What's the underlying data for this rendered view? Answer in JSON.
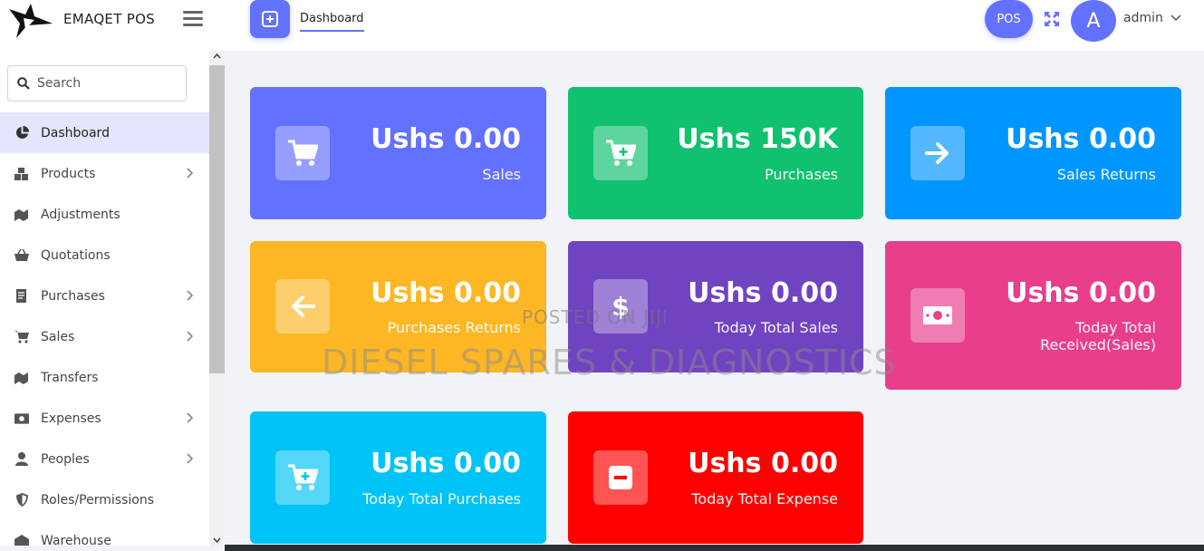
{
  "app": {
    "brand": "EMAQET POS"
  },
  "header": {
    "tab_label": "Dashboard",
    "pos_label": "POS",
    "avatar_letter": "A",
    "user_name": "admin"
  },
  "search": {
    "placeholder": "Search"
  },
  "sidebar": {
    "items": [
      {
        "label": "Dashboard",
        "icon": "pie-chart-icon",
        "active": true
      },
      {
        "label": "Products",
        "icon": "boxes-icon",
        "has_children": true
      },
      {
        "label": "Adjustments",
        "icon": "adjust-icon"
      },
      {
        "label": "Quotations",
        "icon": "basket-icon"
      },
      {
        "label": "Purchases",
        "icon": "receipt-icon",
        "has_children": true
      },
      {
        "label": "Sales",
        "icon": "cart-icon",
        "has_children": true
      },
      {
        "label": "Transfers",
        "icon": "transfer-icon"
      },
      {
        "label": "Expenses",
        "icon": "money-icon",
        "has_children": true
      },
      {
        "label": "Peoples",
        "icon": "user-icon",
        "has_children": true
      },
      {
        "label": "Roles/Permissions",
        "icon": "shield-icon"
      },
      {
        "label": "Warehouse",
        "icon": "warehouse-icon"
      }
    ]
  },
  "cards": [
    {
      "amount": "Ushs 0.00",
      "label": "Sales",
      "color": "#6371ff",
      "icon": "cart-icon"
    },
    {
      "amount": "Ushs 150K",
      "label": "Purchases",
      "color": "#10c16f",
      "icon": "cart-plus-icon"
    },
    {
      "amount": "Ushs 0.00",
      "label": "Sales Returns",
      "color": "#0096ff",
      "icon": "arrow-right-icon"
    },
    {
      "amount": "Ushs 0.00",
      "label": "Purchases Returns",
      "color": "#fdb624",
      "icon": "arrow-left-icon"
    },
    {
      "amount": "Ushs 0.00",
      "label": "Today Total Sales",
      "color": "#7043c1",
      "icon": "dollar-icon"
    },
    {
      "amount": "Ushs 0.00",
      "label_line1": "Today Total",
      "label_line2": "Received(Sales)",
      "color": "#e83e8c",
      "icon": "cash-icon"
    },
    {
      "amount": "Ushs 0.00",
      "label": "Today Total Purchases",
      "color": "#00c3f7",
      "icon": "cart-plus-icon"
    },
    {
      "amount": "Ushs 0.00",
      "label": "Today Total Expense",
      "color": "#fe0000",
      "icon": "minus-box-icon"
    }
  ],
  "watermark": {
    "line1": "POSTED ON JIJI",
    "line2": "DIESEL SPARES & DIAGNOSTICS"
  }
}
